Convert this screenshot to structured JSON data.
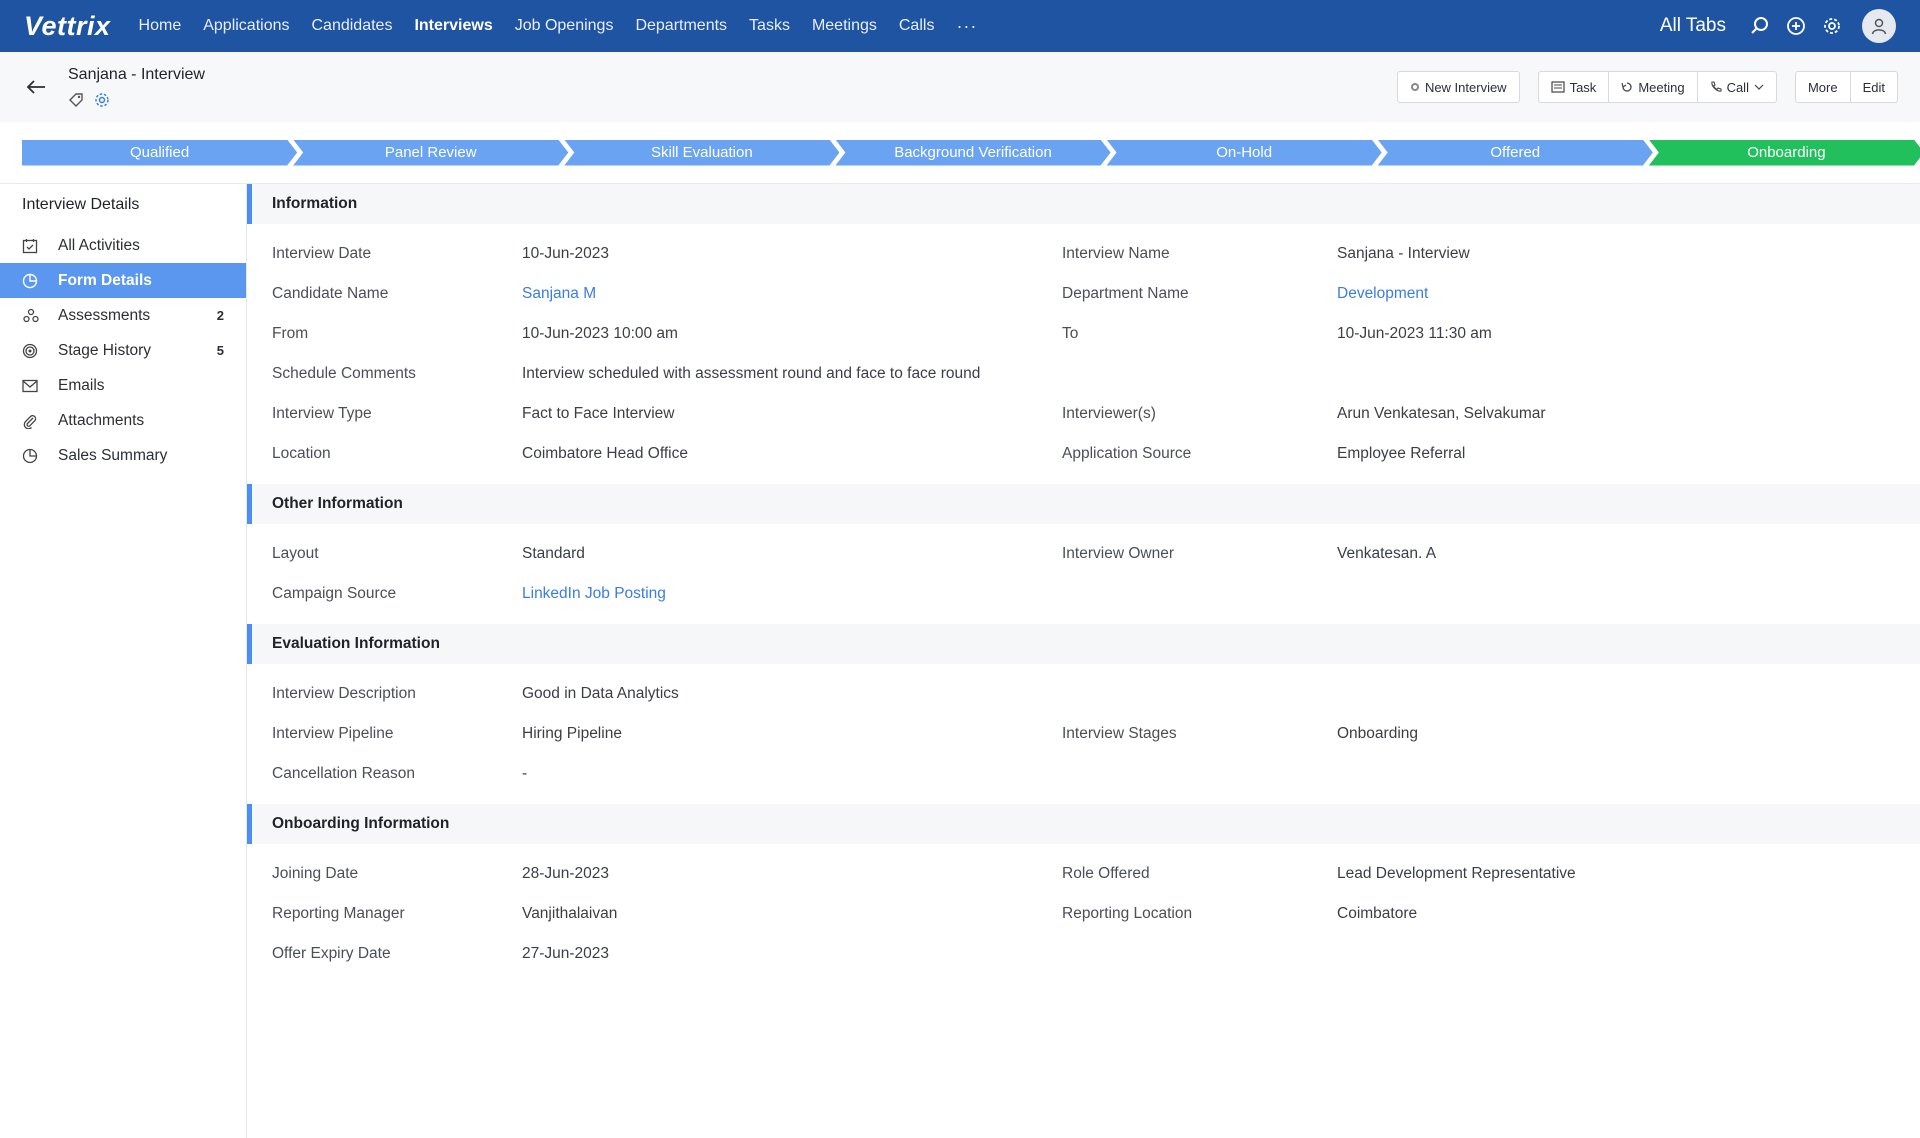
{
  "app": {
    "logo": "Vettrix"
  },
  "nav": {
    "items": [
      "Home",
      "Applications",
      "Candidates",
      "Interviews",
      "Job Openings",
      "Departments",
      "Tasks",
      "Meetings",
      "Calls"
    ],
    "active": "Interviews",
    "more": "···",
    "all_tabs": "All Tabs"
  },
  "record": {
    "title": "Sanjana - Interview",
    "actions": {
      "new_interview": "New Interview",
      "task": "Task",
      "meeting": "Meeting",
      "call": "Call",
      "more": "More",
      "edit": "Edit"
    }
  },
  "pipeline": {
    "stages": [
      "Qualified",
      "Panel Review",
      "Skill Evaluation",
      "Background Verification",
      "On-Hold",
      "Offered",
      "Onboarding"
    ],
    "current": "Onboarding"
  },
  "sidebar": {
    "title": "Interview Details",
    "items": [
      {
        "label": "All Activities",
        "icon": "calendar-check-icon",
        "count": ""
      },
      {
        "label": "Form Details",
        "icon": "pie-icon",
        "count": "",
        "active": true
      },
      {
        "label": "Assessments",
        "icon": "group-icon",
        "count": "2"
      },
      {
        "label": "Stage History",
        "icon": "target-icon",
        "count": "5"
      },
      {
        "label": "Emails",
        "icon": "mail-icon",
        "count": ""
      },
      {
        "label": "Attachments",
        "icon": "paperclip-icon",
        "count": ""
      },
      {
        "label": "Sales Summary",
        "icon": "pie-icon",
        "count": ""
      }
    ]
  },
  "sections": {
    "information": {
      "title": "Information",
      "interview_date_label": "Interview Date",
      "interview_date": "10-Jun-2023",
      "interview_name_label": "Interview Name",
      "interview_name": "Sanjana - Interview",
      "candidate_name_label": "Candidate Name",
      "candidate_name": "Sanjana M",
      "department_name_label": "Department Name",
      "department_name": "Development",
      "from_label": "From",
      "from": "10-Jun-2023 10:00 am",
      "to_label": "To",
      "to": "10-Jun-2023 11:30 am",
      "schedule_comments_label": "Schedule Comments",
      "schedule_comments": "Interview scheduled with assessment round and face to face round",
      "interview_type_label": "Interview Type",
      "interview_type": "Fact to Face Interview",
      "interviewers_label": "Interviewer(s)",
      "interviewers": "Arun Venkatesan, Selvakumar",
      "location_label": "Location",
      "location": "Coimbatore Head Office",
      "application_source_label": "Application Source",
      "application_source": "Employee Referral"
    },
    "other": {
      "title": "Other Information",
      "layout_label": "Layout",
      "layout": "Standard",
      "owner_label": "Interview Owner",
      "owner": "Venkatesan. A",
      "campaign_source_label": "Campaign Source",
      "campaign_source": "LinkedIn Job Posting"
    },
    "evaluation": {
      "title": "Evaluation Information",
      "description_label": "Interview Description",
      "description": "Good in Data Analytics",
      "pipeline_label": "Interview Pipeline",
      "pipeline": "Hiring Pipeline",
      "stages_label": "Interview Stages",
      "stages": "Onboarding",
      "cancellation_label": "Cancellation Reason",
      "cancellation": "-"
    },
    "onboarding": {
      "title": "Onboarding Information",
      "joining_date_label": "Joining Date",
      "joining_date": "28-Jun-2023",
      "role_offered_label": "Role Offered",
      "role_offered": "Lead Development Representative",
      "reporting_manager_label": "Reporting Manager",
      "reporting_manager": "Vanjithalaivan",
      "reporting_location_label": "Reporting Location",
      "reporting_location": "Coimbatore",
      "offer_expiry_label": "Offer Expiry Date",
      "offer_expiry": "27-Jun-2023"
    }
  },
  "colors": {
    "topbar": "#1f54a3",
    "stage": "#6aa3f1",
    "stage_current": "#22c05d",
    "sidebar_active": "#5b97ef",
    "link": "#3b7de0"
  }
}
